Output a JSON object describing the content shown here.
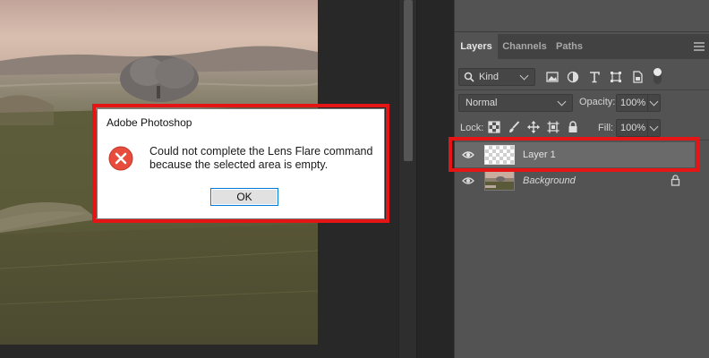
{
  "dialog": {
    "title": "Adobe Photoshop",
    "message_line1": "Could not complete the Lens Flare command",
    "message_line2": "because the selected area is empty.",
    "ok_label": "OK",
    "icon": "error-icon"
  },
  "layers_panel": {
    "tabs": [
      {
        "label": "Layers",
        "active": true
      },
      {
        "label": "Channels",
        "active": false
      },
      {
        "label": "Paths",
        "active": false
      }
    ],
    "filter": {
      "label": "Kind"
    },
    "blend_mode": "Normal",
    "opacity_label": "Opacity:",
    "opacity_value": "100%",
    "lock_label": "Lock:",
    "fill_label": "Fill:",
    "fill_value": "100%",
    "layers": [
      {
        "name": "Layer 1",
        "visible": true,
        "selected": true,
        "locked": false,
        "thumbnail": "transparent"
      },
      {
        "name": "Background",
        "visible": true,
        "selected": false,
        "locked": true,
        "thumbnail": "photo"
      }
    ]
  },
  "colors": {
    "highlight": "#e51515",
    "panel_bg": "#535353",
    "dialog_bg": "#ffffff",
    "error_red": "#e74c3c"
  }
}
